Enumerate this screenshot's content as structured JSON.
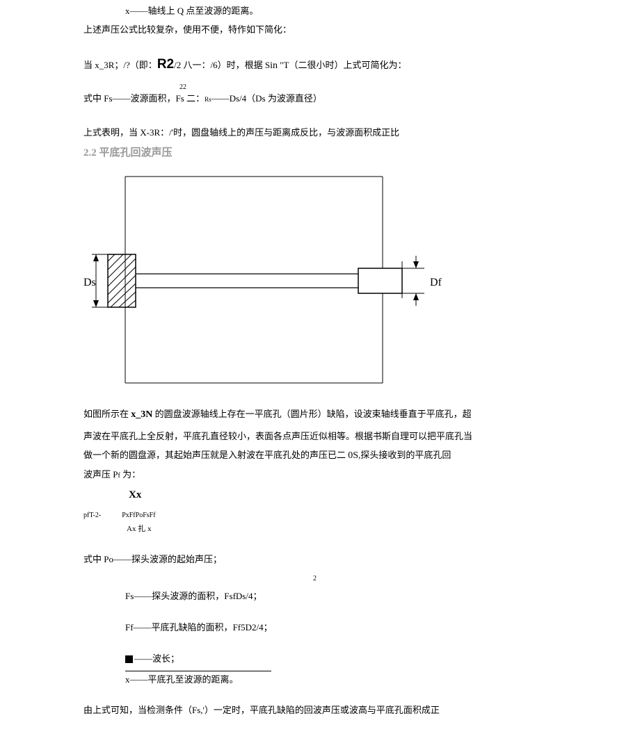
{
  "p1": "x——轴线上 Q 点至波源的距离。",
  "p2": "上述声压公式比较复杂，使用不便，特作如下简化：",
  "p3_a": "当 x_3R；/?（即：",
  "p3_b": "R2",
  "p3_c": "/2 八一：/6）时，根据 S",
  "p3_d": "in",
  "p3_e": " \"T（二很小时）上式可简化为：",
  "p4_sup": "22",
  "p4_a": "式中 Fs——波源面积，Fs 二：",
  "p4_b": "Rs",
  "p4_c": "——Ds/4（Ds 为波源直径）",
  "p5": "上式表明，当 X-3R：/'时，圆盘轴线上的声压与距离成反比，与波源面积成正比",
  "sec22": "2.2 平底孔回波声压",
  "fig_ds": "Ds",
  "fig_df": "Df",
  "p6_a": "如图所示在 ",
  "p6_b": "x_3N",
  "p6_c": " 的圆盘波源轴线上存在一平底孔（圆片形）缺陷，设波束轴线垂直于平底孔，超",
  "p7_a": "声波在平底孔上全反射，平底孔直径较小，表面各点声压近似相等。根据书斯自理可以把平底孔当",
  "p7_b": "做一个新的圆盘源，其起始声压就是入射波在平底孔处的声压已二 ",
  "p7_c": "0S",
  "p7_d": ",探头接收到的平底孔回",
  "p8_a": "波声压 P",
  "p8_b": "f",
  "p8_c": " 为：",
  "fx_xx": "Xx",
  "fx_lab": "pfT-2-",
  "fx_num": "PxFfPoFsFf",
  "fx_den": "Ax 扎 x",
  "p9": "式中 Po——探头波源的起始声压；",
  "p10_sup": "2",
  "p10": "Fs——探头波源的面积，FsfDs/4；",
  "p11_a": "Ff——平底孔缺陷的面积，",
  "p11_b": "Ff5D2",
  "p11_c": "/4；",
  "p12": "——波长；",
  "p13": "x——平底孔至波源的距离。",
  "p14": "由上式可知，当检测条件（Fs,'）一定时，平底孔缺陷的回波声压或波高与平底孔面积成正"
}
